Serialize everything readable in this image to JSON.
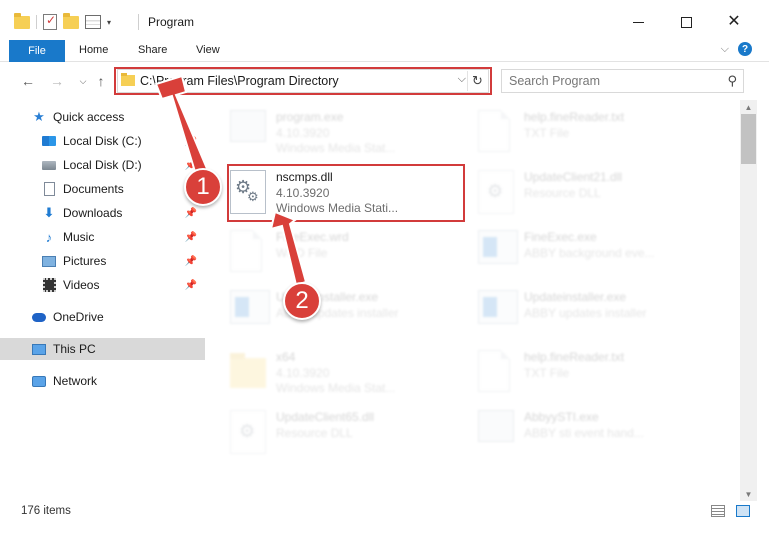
{
  "window": {
    "title": "Program",
    "quick_access_dropdown": "▾"
  },
  "ribbon": {
    "file": "File",
    "home": "Home",
    "share": "Share",
    "view": "View",
    "help": "?"
  },
  "address": {
    "path": "C:\\Program Files\\Program Directory",
    "search_placeholder": "Search Program"
  },
  "nav": {
    "quick_access": "Quick access",
    "items": [
      {
        "label": "Local Disk (C:)"
      },
      {
        "label": "Local Disk (D:)"
      },
      {
        "label": "Documents"
      },
      {
        "label": "Downloads"
      },
      {
        "label": "Music"
      },
      {
        "label": "Pictures"
      },
      {
        "label": "Videos"
      }
    ],
    "onedrive": "OneDrive",
    "this_pc": "This PC",
    "network": "Network"
  },
  "files": [
    {
      "name": "program.exe",
      "line2": "4.10.3920",
      "line3": "Windows Media Stat..."
    },
    {
      "name": "help.fineReader.txt",
      "line2": "TXT File",
      "line3": ""
    },
    {
      "name": "nscmps.dll",
      "line2": "4.10.3920",
      "line3": "Windows Media Stati..."
    },
    {
      "name": "UpdateClient21.dll",
      "line2": "Resource DLL",
      "line3": ""
    },
    {
      "name": "FineExec.wrd",
      "line2": "WRD File",
      "line3": ""
    },
    {
      "name": "FineExec.exe",
      "line2": "ABBY background eve...",
      "line3": ""
    },
    {
      "name": "Updateinstaller.exe",
      "line2": "ABBY updates installer",
      "line3": ""
    },
    {
      "name": "Updateinstaller.exe",
      "line2": "ABBY updates installer",
      "line3": ""
    },
    {
      "name": "x64",
      "line2": "4.10.3920",
      "line3": "Windows Media Stat..."
    },
    {
      "name": "help.fineReader.txt",
      "line2": "TXT File",
      "line3": ""
    },
    {
      "name": "UpdateClient65.dll",
      "line2": "Resource DLL",
      "line3": ""
    },
    {
      "name": "AbbyySTI.exe",
      "line2": "ABBY sti event hand...",
      "line3": ""
    }
  ],
  "status": {
    "items_count": "176 items"
  },
  "callouts": {
    "one": "1",
    "two": "2"
  },
  "colors": {
    "accent": "#1979ca",
    "highlight": "#d23b3b",
    "callout": "#d9403a"
  }
}
